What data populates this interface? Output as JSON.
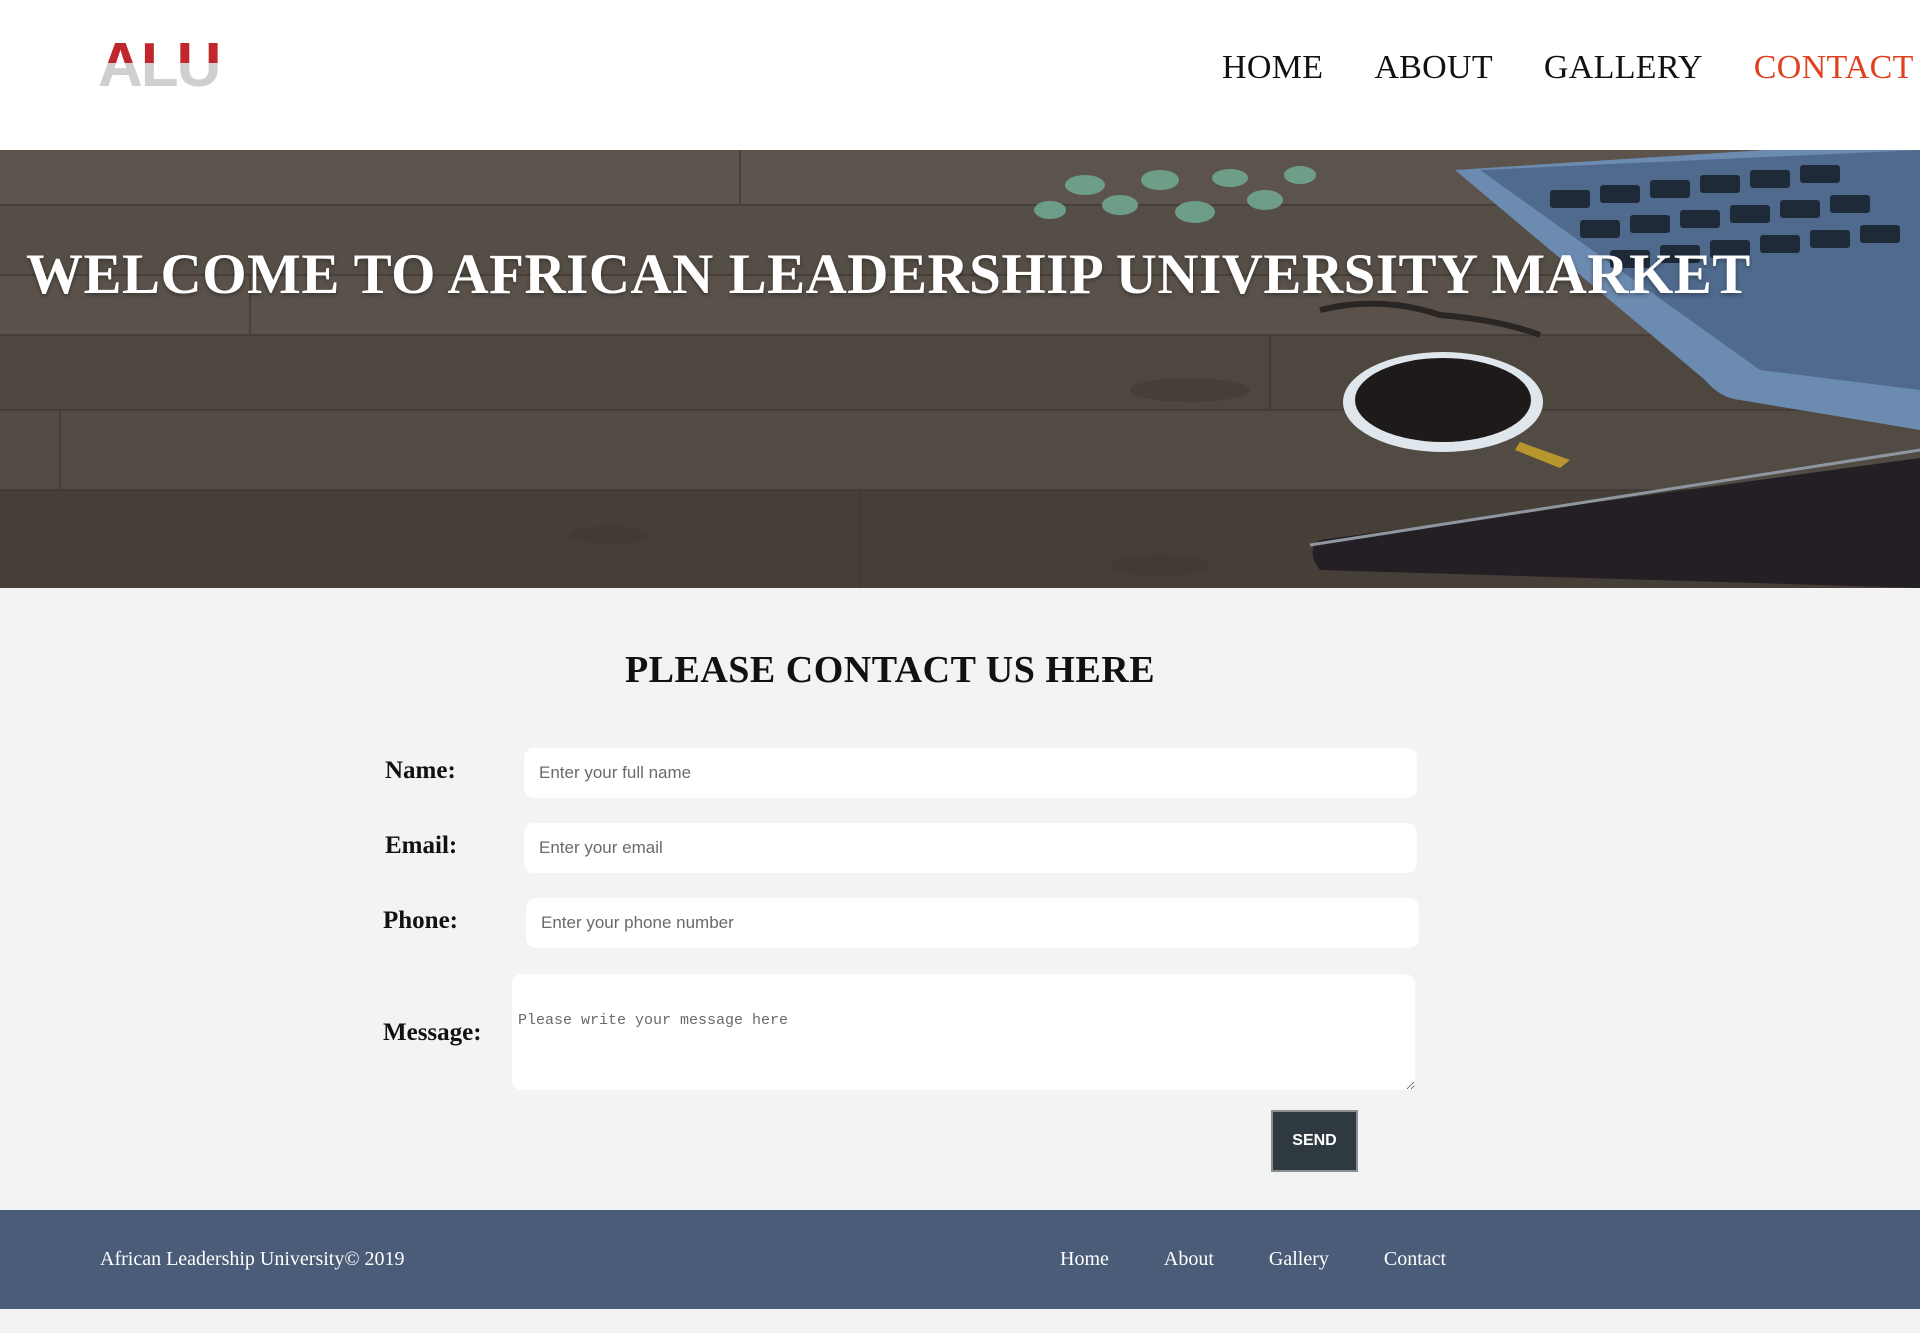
{
  "header": {
    "logo_text": "ALU",
    "nav": [
      {
        "label": "HOME",
        "active": false
      },
      {
        "label": "ABOUT",
        "active": false
      },
      {
        "label": "GALLERY",
        "active": false
      },
      {
        "label": "CONTACT",
        "active": true
      }
    ],
    "active_color": "#e0401e",
    "logo_colors": {
      "top": "#c0272d",
      "bottom": "#cfcfcf"
    }
  },
  "hero": {
    "title": "WELCOME TO AFRICAN LEADERSHIP UNIVERSITY MARKET"
  },
  "contact": {
    "title": "PLEASE CONTACT US HERE",
    "fields": {
      "name": {
        "label": "Name:",
        "placeholder": "Enter your full name",
        "value": ""
      },
      "email": {
        "label": "Email:",
        "placeholder": "Enter your email",
        "value": ""
      },
      "phone": {
        "label": "Phone:",
        "placeholder": "Enter your phone number",
        "value": ""
      },
      "message": {
        "label": "Message:",
        "placeholder": "Please write your message here",
        "value": ""
      }
    },
    "send_label": "SEND"
  },
  "footer": {
    "copyright": "African Leadership University© 2019",
    "links": [
      "Home",
      "About",
      "Gallery",
      "Contact"
    ],
    "background": "#4b5c78"
  }
}
